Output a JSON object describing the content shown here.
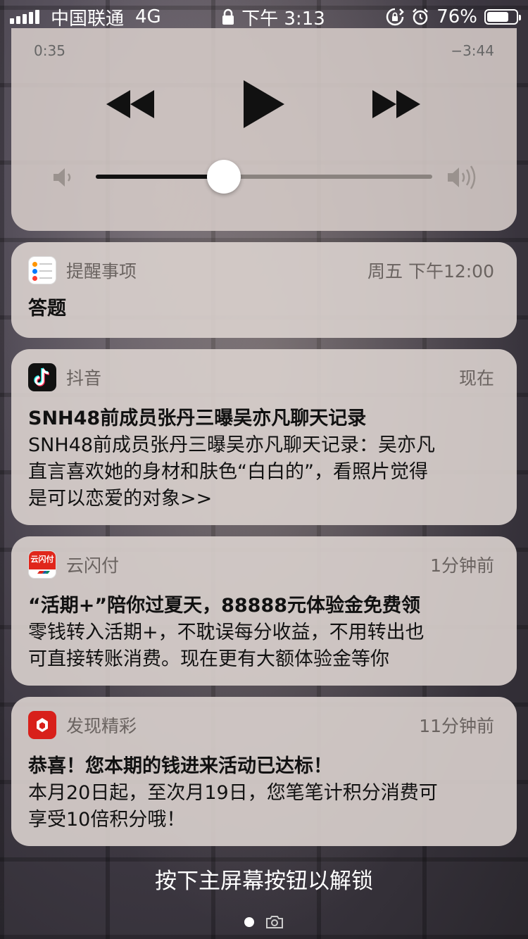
{
  "status_bar": {
    "carrier": "中国联通",
    "network": "4G",
    "time": "下午 3:13",
    "battery_percent": "76%",
    "battery_level": 0.76
  },
  "music": {
    "elapsed": "0:35",
    "remaining": "−3:44",
    "volume_level": 0.38
  },
  "notifications": [
    {
      "app": "提醒事项",
      "time": "周五 下午12:00",
      "title": "答题",
      "body": "",
      "icon": "reminders-icon"
    },
    {
      "app": "抖音",
      "time": "现在",
      "title": "SNH48前成员张丹三曝吴亦凡聊天记录",
      "body_lines": [
        "SNH48前成员张丹三曝吴亦凡聊天记录：吴亦凡",
        "直言喜欢她的身材和肤色“白白的”，看照片觉得",
        "是可以恋爱的对象>>"
      ],
      "icon": "douyin-icon"
    },
    {
      "app": "云闪付",
      "time": "1分钟前",
      "title": "“活期+”陪你过夏天，88888元体验金免费领",
      "body_lines": [
        "零钱转入活期+，不耽误每分收益，不用转出也",
        "可直接转账消费。现在更有大额体验金等你"
      ],
      "icon": "unionpay-icon",
      "icon_text": "云闪付"
    },
    {
      "app": "发现精彩",
      "time": "11分钟前",
      "title": "恭喜！您本期的钱进来活动已达标！",
      "body_lines": [
        "本月20日起，至次月19日，您笔笔计积分消费可",
        "享受10倍积分哦！"
      ],
      "icon": "discover-icon"
    }
  ],
  "unlock_hint": "按下主屏幕按钮以解锁",
  "colors": {
    "card": "#dad2ce",
    "douyin_cyan": "#25f4ee",
    "douyin_red": "#fe2c55",
    "unionpay_red": "#e0261b",
    "discover_red": "#d8201a"
  }
}
